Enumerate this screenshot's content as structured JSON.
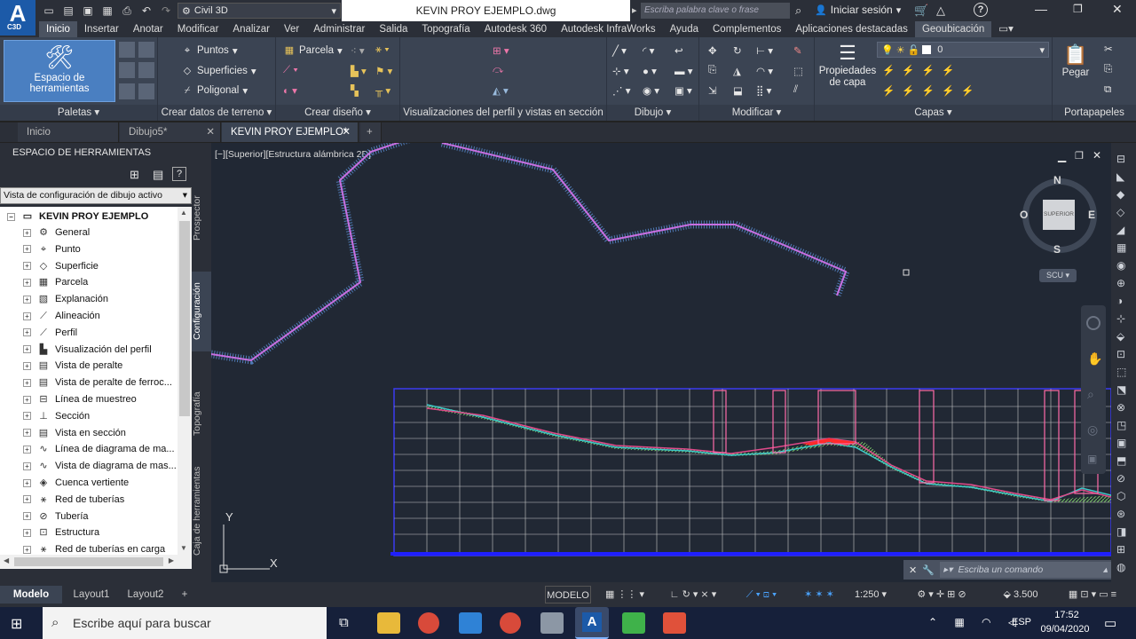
{
  "app": {
    "logo_text": "A",
    "logo_sub": "C3D",
    "workspace": "Civil 3D",
    "document_title": "KEVIN PROY EJEMPLO.dwg",
    "search_placeholder": "Escriba palabra clave o frase",
    "signin": "Iniciar sesión",
    "help": "?"
  },
  "menu": {
    "tabs": [
      "Inicio",
      "Insertar",
      "Anotar",
      "Modificar",
      "Analizar",
      "Ver",
      "Administrar",
      "Salida",
      "Topografía",
      "Autodesk 360",
      "Autodesk InfraWorks",
      "Ayuda",
      "Complementos",
      "Aplicaciones destacadas",
      "Geoubicación"
    ]
  },
  "ribbon": {
    "paletas": {
      "big_button": "Espacio de herramientas",
      "title": "Paletas"
    },
    "terreno": {
      "puntos": "Puntos",
      "superficies": "Superficies",
      "poligonal": "Poligonal",
      "title": "Crear datos de terreno"
    },
    "diseno": {
      "parcela": "Parcela",
      "title": "Crear diseño"
    },
    "perfil": {
      "title": "Visualizaciones del perfil y vistas en sección"
    },
    "dibujo": {
      "title": "Dibujo"
    },
    "modificar": {
      "title": "Modificar"
    },
    "capas": {
      "propiedades": "Propiedades de capa",
      "layer_value": "0",
      "title": "Capas"
    },
    "portapapeles": {
      "pegar": "Pegar",
      "title": "Portapapeles"
    }
  },
  "doc_tabs": [
    {
      "label": "Inicio"
    },
    {
      "label": "Dibujo5*"
    },
    {
      "label": "KEVIN PROY EJEMPLO*"
    }
  ],
  "toolspace": {
    "header": "ESPACIO DE HERRAMIENTAS",
    "view_select": "Vista de configuración de dibujo activo",
    "root": "KEVIN PROY EJEMPLO",
    "items": [
      "General",
      "Punto",
      "Superficie",
      "Parcela",
      "Explanación",
      "Alineación",
      "Perfil",
      "Visualización del perfil",
      "Vista de peralte",
      "Vista de peralte de ferroc...",
      "Línea de muestreo",
      "Sección",
      "Vista en sección",
      "Línea de diagrama de ma...",
      "Vista de diagrama de mas...",
      "Cuenca vertiente",
      "Red de tuberías",
      "Tubería",
      "Estructura",
      "Red de tuberías en carga"
    ],
    "vertical_tabs": [
      "Prospector",
      "Configuración",
      "Topografía",
      "Caja de herramientas"
    ]
  },
  "viewport": {
    "label": "[−][Superior][Estructura alámbrica 2D]",
    "compass": {
      "n": "N",
      "s": "S",
      "e": "E",
      "w": "O",
      "cube": "SUPERIOR",
      "ucs": "SCU"
    },
    "ucs_x": "X",
    "ucs_y": "Y",
    "command_placeholder": "Escriba un comando"
  },
  "status": {
    "layout_tabs": [
      "Modelo",
      "Layout1",
      "Layout2"
    ],
    "model": "MODELO",
    "scale": "1:250",
    "value": "3.500"
  },
  "taskbar": {
    "search": "Escribe aquí para buscar",
    "lang": "ESP",
    "time": "17:52",
    "date": "09/04/2020"
  }
}
